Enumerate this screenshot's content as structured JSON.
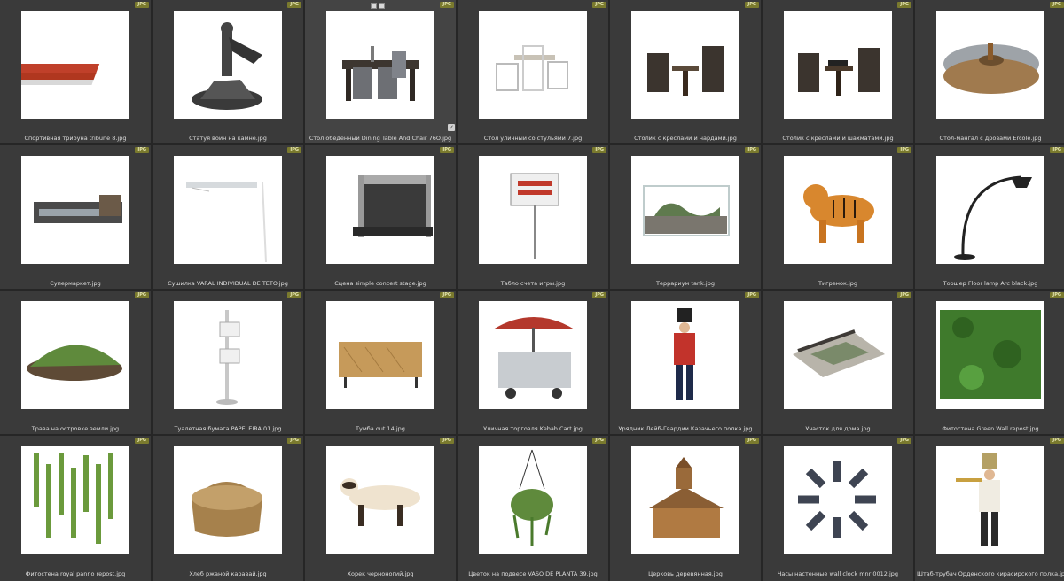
{
  "badge": "JPG",
  "items": [
    {
      "label": "Спортивная трибуна tribune 8.jpg",
      "icon": "tribune"
    },
    {
      "label": "Статуя воин на камне.jpg",
      "icon": "statue"
    },
    {
      "label": "Стол обеденный Dining Table And Chair 76О.jpg",
      "icon": "dining-table"
    },
    {
      "label": "Стол уличный со стульями 7.jpg",
      "icon": "outdoor-table"
    },
    {
      "label": "Столик с креслами и нардами.jpg",
      "icon": "backgammon-table"
    },
    {
      "label": "Столик с креслами и шахматами.jpg",
      "icon": "chess-table"
    },
    {
      "label": "Стол-мангал с дровами Ercole.jpg",
      "icon": "fire-table"
    },
    {
      "label": "Супермаркет.jpg",
      "icon": "supermarket"
    },
    {
      "label": "Сушилка VARAL INDIVIDUAL DE TETO.jpg",
      "icon": "ceiling-dryer"
    },
    {
      "label": "Сцена simple concert stage.jpg",
      "icon": "stage"
    },
    {
      "label": "Табло счета игры.jpg",
      "icon": "scoreboard"
    },
    {
      "label": "Террариум tank.jpg",
      "icon": "terrarium"
    },
    {
      "label": "Тигренок.jpg",
      "icon": "tiger-cub"
    },
    {
      "label": "Торшер Floor lamp Arc black.jpg",
      "icon": "floor-lamp"
    },
    {
      "label": "Трава на островке земли.jpg",
      "icon": "grass-patch"
    },
    {
      "label": "Туалетная бумага PAPELEIRA 01.jpg",
      "icon": "toilet-paper"
    },
    {
      "label": "Тумба out 14.jpg",
      "icon": "sideboard"
    },
    {
      "label": "Уличная торговля Kebab Cart.jpg",
      "icon": "kebab-cart"
    },
    {
      "label": "Урядник Лейб-Гвардии Казачьего полка.jpg",
      "icon": "guard-soldier"
    },
    {
      "label": "Участок для дома.jpg",
      "icon": "land-plot"
    },
    {
      "label": "Фитостена Green Wall repost.jpg",
      "icon": "green-wall"
    },
    {
      "label": "Фитостена royal panno repost.jpg",
      "icon": "plant-panels"
    },
    {
      "label": "Хлеб ржаной каравай.jpg",
      "icon": "rye-bread"
    },
    {
      "label": "Хорек черноногий.jpg",
      "icon": "ferret"
    },
    {
      "label": "Цветок на подвесе VASO DE PLANTA 39.jpg",
      "icon": "hanging-plant"
    },
    {
      "label": "Церковь деревянная.jpg",
      "icon": "wooden-church"
    },
    {
      "label": "Часы настенные wall clock mnr 0012.jpg",
      "icon": "wall-clock"
    },
    {
      "label": "Штаб-трубач Орденского кирасирского полка.jpg",
      "icon": "trumpeter"
    }
  ]
}
